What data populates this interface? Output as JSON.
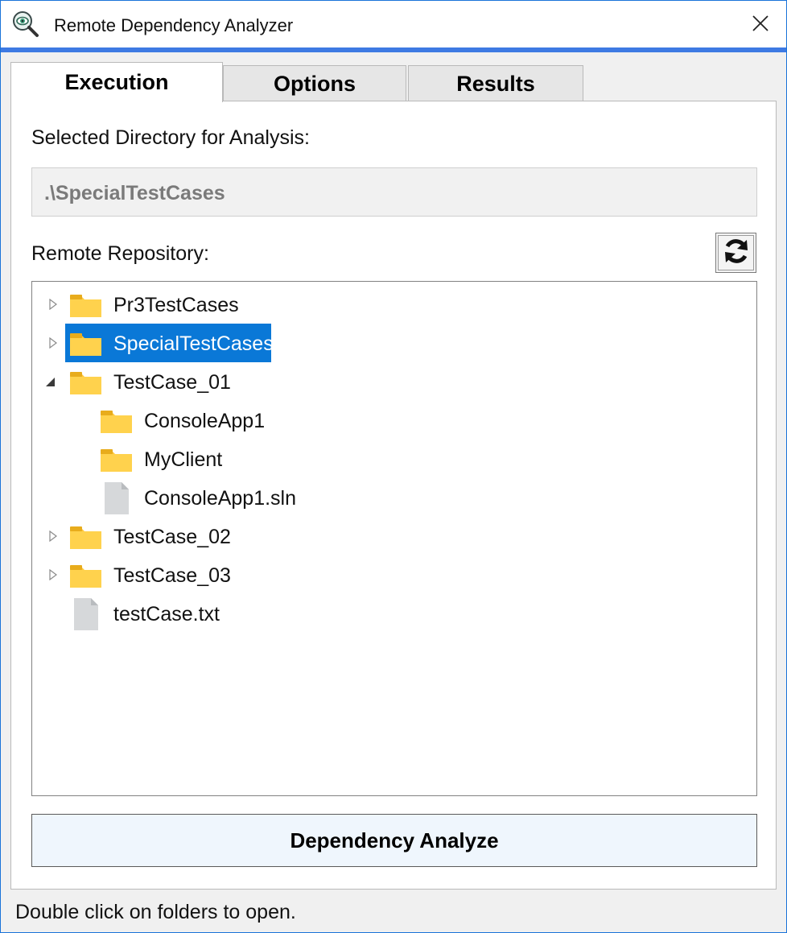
{
  "window": {
    "title": "Remote Dependency Analyzer",
    "app_icon": "magnifier-eye-icon",
    "close_icon": "close-icon",
    "accent_color": "#3e7ae3"
  },
  "tabs": [
    {
      "label": "Execution",
      "active": true
    },
    {
      "label": "Options",
      "active": false
    },
    {
      "label": "Results",
      "active": false
    }
  ],
  "execution": {
    "selected_dir_label": "Selected Directory for Analysis:",
    "selected_dir_value": ".\\SpecialTestCases",
    "repo_label": "Remote Repository:",
    "refresh_icon": "refresh-icon",
    "tree": [
      {
        "label": "Pr3TestCases",
        "type": "folder",
        "level": 0,
        "expander": "collapsed",
        "selected": false
      },
      {
        "label": "SpecialTestCases",
        "type": "folder",
        "level": 0,
        "expander": "collapsed",
        "selected": true
      },
      {
        "label": "TestCase_01",
        "type": "folder",
        "level": 0,
        "expander": "expanded",
        "selected": false
      },
      {
        "label": "ConsoleApp1",
        "type": "folder",
        "level": 1,
        "expander": "none",
        "selected": false
      },
      {
        "label": "MyClient",
        "type": "folder",
        "level": 1,
        "expander": "none",
        "selected": false
      },
      {
        "label": "ConsoleApp1.sln",
        "type": "file",
        "level": 1,
        "expander": "none",
        "selected": false
      },
      {
        "label": "TestCase_02",
        "type": "folder",
        "level": 0,
        "expander": "collapsed",
        "selected": false
      },
      {
        "label": "TestCase_03",
        "type": "folder",
        "level": 0,
        "expander": "collapsed",
        "selected": false
      },
      {
        "label": "testCase.txt",
        "type": "file",
        "level": 0,
        "expander": "none",
        "selected": false
      }
    ],
    "analyze_button": "Dependency Analyze",
    "selection_color": "#0a78d7",
    "folder_color": "#ffc83d"
  },
  "status": "Double click on folders to open."
}
